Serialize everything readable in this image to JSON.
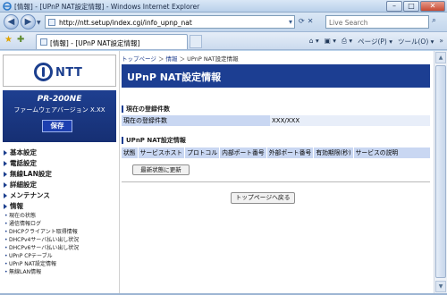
{
  "window": {
    "title": "[情報] - [UPnP NAT設定情報] - Windows Internet Explorer",
    "min": "–",
    "max": "□",
    "close": "✕"
  },
  "address": {
    "url": "http://ntt.setup/index.cgi/info_upnp_nat",
    "search_placeholder": "Live Search"
  },
  "tab": {
    "title": "[情報] - [UPnP NAT設定情報]"
  },
  "commands": {
    "home": "⌂ ▾",
    "feeds": "▣ ▾",
    "print": "⎙ ▾",
    "page": "ページ(P) ▾",
    "tools": "ツール(O) ▾",
    "more": "»"
  },
  "sidebar": {
    "logo": "NTT",
    "model": "PR-200NE",
    "firmware": "ファームウェアバージョン X.XX",
    "save": "保存",
    "menu": [
      {
        "label": "基本設定"
      },
      {
        "label": "電話設定"
      },
      {
        "label": "無線LAN設定"
      },
      {
        "label": "詳細設定"
      },
      {
        "label": "メンテナンス"
      },
      {
        "label": "情報"
      }
    ],
    "info_items": [
      "現在の状態",
      "通信情報ログ",
      "DHCPクライアント取得情報",
      "DHCPv4サーバ払い出し状況",
      "DHCPv6サーバ払い出し状況",
      "UPnP CPテーブル",
      "UPnP NAT設定情報",
      "無線LAN情報"
    ]
  },
  "main": {
    "breadcrumb": {
      "top": "トップページ",
      "info": "情報",
      "current": "UPnP NAT設定情報",
      "sep": " ＞ "
    },
    "heading": "UPnP NAT設定情報",
    "registered": {
      "section_title": "現在の登録件数",
      "label": "現在の登録件数",
      "value": "XXX/XXX"
    },
    "nat_table": {
      "section_title": "UPnP NAT設定情報",
      "columns": [
        "状態",
        "サービスホスト",
        "プロトコル",
        "内部ポート番号",
        "外部ポート番号",
        "有効期限(秒)",
        "サービスの説明"
      ]
    },
    "refresh_button": "最新状態に更新",
    "back_button": "トップページへ戻る"
  }
}
